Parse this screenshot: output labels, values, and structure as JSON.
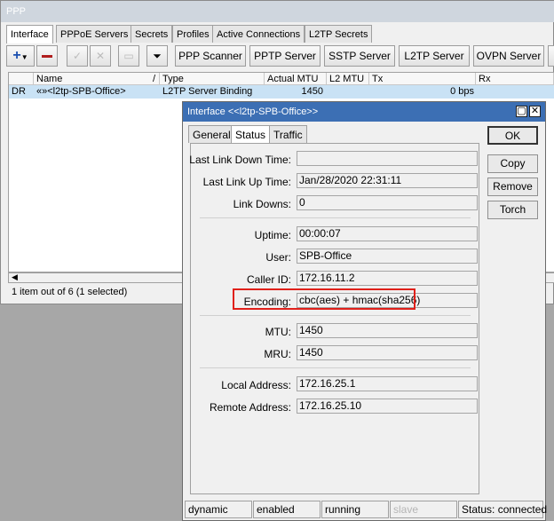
{
  "window": {
    "title": "PPP"
  },
  "tabs": [
    "Interface",
    "PPPoE Servers",
    "Secrets",
    "Profiles",
    "Active Connections",
    "L2TP Secrets"
  ],
  "toolbar": {
    "buttons": [
      "PPP Scanner",
      "PPTP Server",
      "SSTP Server",
      "L2TP Server",
      "OVPN Server"
    ]
  },
  "table": {
    "columns": [
      "Name",
      "Type",
      "Actual MTU",
      "L2 MTU",
      "Tx",
      "Rx"
    ],
    "sort_marker": "/",
    "row": {
      "flags": "DR",
      "name": "«»<l2tp-SPB-Office>",
      "type": "L2TP Server Binding",
      "actual_mtu": "1450",
      "l2_mtu": "",
      "tx": "0 bps",
      "rx": ""
    }
  },
  "status": {
    "count": "1 item out of 6 (1 selected)"
  },
  "dialog": {
    "title": "Interface <<l2tp-SPB-Office>>",
    "tabs": [
      "General",
      "Status",
      "Traffic"
    ],
    "active_tab": "Status",
    "fields": {
      "last_link_down_time": {
        "label": "Last Link Down Time:",
        "value": ""
      },
      "last_link_up_time": {
        "label": "Last Link Up Time:",
        "value": "Jan/28/2020 22:31:11"
      },
      "link_downs": {
        "label": "Link Downs:",
        "value": "0"
      },
      "uptime": {
        "label": "Uptime:",
        "value": "00:00:07"
      },
      "user": {
        "label": "User:",
        "value": "SPB-Office"
      },
      "caller_id": {
        "label": "Caller ID:",
        "value": "172.16.11.2"
      },
      "encoding": {
        "label": "Encoding:",
        "value": "cbc(aes) + hmac(sha256)"
      },
      "mtu": {
        "label": "MTU:",
        "value": "1450"
      },
      "mru": {
        "label": "MRU:",
        "value": "1450"
      },
      "local_address": {
        "label": "Local Address:",
        "value": "172.16.25.1"
      },
      "remote_address": {
        "label": "Remote Address:",
        "value": "172.16.25.10"
      }
    },
    "buttons": {
      "ok": "OK",
      "copy": "Copy",
      "remove": "Remove",
      "torch": "Torch"
    },
    "statusbar": [
      "dynamic",
      "enabled",
      "running",
      "slave",
      "Status: connected"
    ],
    "highlight_color": "#e0201a"
  }
}
